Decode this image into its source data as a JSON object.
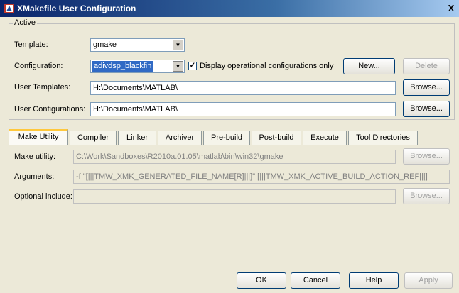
{
  "window": {
    "title": "XMakefile User Configuration",
    "close_glyph": "X"
  },
  "active_group": {
    "label": "Active",
    "template": {
      "label": "Template:",
      "value": "gmake"
    },
    "configuration": {
      "label": "Configuration:",
      "value": "adivdsp_blackfin",
      "checkbox_label": "Display operational configurations only",
      "checked": true
    },
    "new_button": "New...",
    "delete_button": "Delete",
    "user_templates": {
      "label": "User Templates:",
      "value": "H:\\Documents\\MATLAB\\",
      "browse": "Browse..."
    },
    "user_configurations": {
      "label": "User Configurations:",
      "value": "H:\\Documents\\MATLAB\\",
      "browse": "Browse..."
    }
  },
  "tabs": [
    "Make Utility",
    "Compiler",
    "Linker",
    "Archiver",
    "Pre-build",
    "Post-build",
    "Execute",
    "Tool Directories"
  ],
  "make_utility": {
    "make_utility": {
      "label": "Make utility:",
      "value": "C:\\Work\\Sandboxes\\R2010a.01.05\\matlab\\bin\\win32\\gmake",
      "browse": "Browse..."
    },
    "arguments": {
      "label": "Arguments:",
      "value": "-f \"[|||TMW_XMK_GENERATED_FILE_NAME[R]|||]\" [|||TMW_XMK_ACTIVE_BUILD_ACTION_REF|||]"
    },
    "optional_include": {
      "label": "Optional include:",
      "value": "",
      "browse": "Browse..."
    }
  },
  "footer": {
    "ok": "OK",
    "cancel": "Cancel",
    "help": "Help",
    "apply": "Apply"
  }
}
